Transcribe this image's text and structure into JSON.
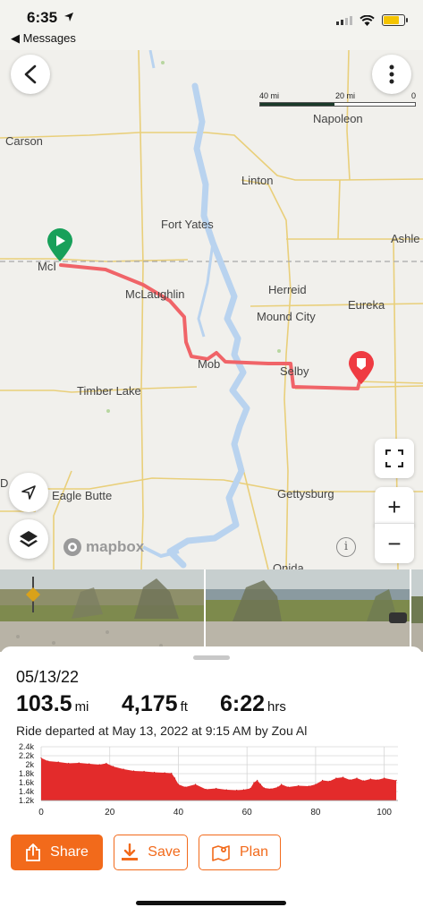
{
  "status_bar": {
    "time": "6:35",
    "back_app": "◀ Messages"
  },
  "map": {
    "scale": {
      "left": "40 mi",
      "mid": "20 mi",
      "right": "0"
    },
    "cities": {
      "napoleon": "Napoleon",
      "carson": "Carson",
      "linton": "Linton",
      "fort_yates": "Fort Yates",
      "ashley": "Ashle",
      "mcintosh": "McI",
      "mclaughlin": "McLaughlin",
      "herreid": "Herreid",
      "eureka": "Eureka",
      "mound_city": "Mound City",
      "mobridge": "Mob",
      "selby": "Selby",
      "timber_lake": "Timber Lake",
      "eagle_butte": "Eagle Butte",
      "gettysburg": "Gettysburg",
      "onida": "Onida",
      "edge_left": "D"
    },
    "attribution": "mapbox",
    "info_glyph": "i",
    "zoom_in": "+",
    "zoom_out": "−",
    "icons": [
      "back-arrow-icon",
      "more-vertical-icon",
      "fullscreen-icon",
      "locate-arrow-icon",
      "layers-icon",
      "start-pin-icon",
      "end-pin-icon"
    ],
    "route_color": "#f06468"
  },
  "ride": {
    "date": "05/13/22",
    "distance": {
      "value": "103.5",
      "unit": "mi"
    },
    "elevation_gain": {
      "value": "4,175",
      "unit": "ft"
    },
    "duration": {
      "value": "6:22",
      "unit": "hrs"
    },
    "description": "Ride departed at May 13, 2022 at 9:15 AM by Zou Al"
  },
  "chart_data": {
    "type": "area",
    "title": "",
    "xlabel": "",
    "ylabel": "",
    "x_ticks": [
      "0",
      "20",
      "40",
      "60",
      "80",
      "100"
    ],
    "y_ticks": [
      "2.4k",
      "2.2k",
      "2k",
      "1.8k",
      "1.6k",
      "1.4k",
      "1.2k"
    ],
    "xlim": [
      0,
      104
    ],
    "ylim": [
      1200,
      2400
    ],
    "color": "#e32b2b",
    "x": [
      0,
      2,
      5,
      8,
      11,
      14,
      17,
      19,
      21,
      24,
      27,
      30,
      33,
      36,
      38,
      39,
      40,
      42,
      45,
      48,
      51,
      54,
      57,
      59,
      61,
      62,
      63,
      64,
      65,
      67,
      69,
      70,
      72,
      75,
      78,
      80,
      82,
      84,
      86,
      88,
      90,
      92,
      94,
      96,
      98,
      100,
      103.5
    ],
    "y": [
      2150,
      2080,
      2060,
      2030,
      2040,
      2020,
      2000,
      2030,
      1960,
      1900,
      1860,
      1850,
      1830,
      1820,
      1810,
      1700,
      1560,
      1500,
      1560,
      1450,
      1470,
      1440,
      1430,
      1440,
      1470,
      1600,
      1650,
      1560,
      1480,
      1460,
      1500,
      1560,
      1500,
      1530,
      1520,
      1560,
      1650,
      1630,
      1700,
      1720,
      1660,
      1700,
      1640,
      1680,
      1660,
      1700,
      1650
    ]
  },
  "actions": {
    "share": "Share",
    "save": "Save",
    "plan": "Plan"
  }
}
